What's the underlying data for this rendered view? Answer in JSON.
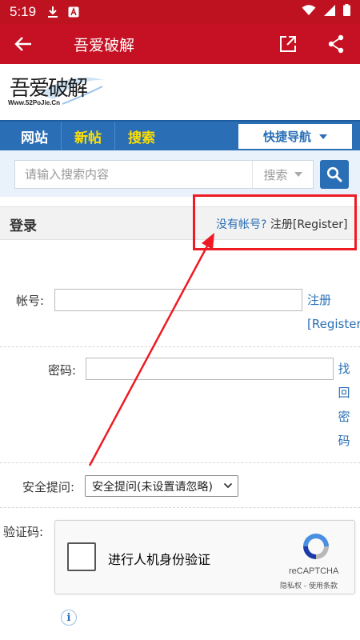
{
  "status_bar": {
    "time": "5:19"
  },
  "app_bar": {
    "title": "吾爱破解"
  },
  "logo": {
    "text": "吾爱破解",
    "url": "Www.52PoJie.Cn"
  },
  "nav": {
    "items": [
      "网站",
      "新帖",
      "搜索"
    ],
    "quick_nav_label": "快捷导航",
    "colors": {
      "bar": "#2a6fb6",
      "highlight": "#ffde00"
    }
  },
  "search": {
    "placeholder": "请输入搜索内容",
    "type_label": "搜索"
  },
  "login": {
    "title": "登录",
    "register_prompt": "没有帐号?",
    "register_link": "注册[Register]"
  },
  "form": {
    "account_label": "帐号:",
    "account_register_link_1": "注册",
    "account_register_link_2": "[Register]",
    "password_label": "密码:",
    "find_password_chars": [
      "找",
      "回",
      "密",
      "码"
    ],
    "security_label": "安全提问:",
    "security_selected": "安全提问(未设置请忽略)",
    "captcha_label": "验证码:"
  },
  "captcha": {
    "checkbox_label": "进行人机身份验证",
    "brand": "reCAPTCHA",
    "links": "隐私权 - 使用条款"
  },
  "annotation": {
    "color": "#ee1b24"
  }
}
